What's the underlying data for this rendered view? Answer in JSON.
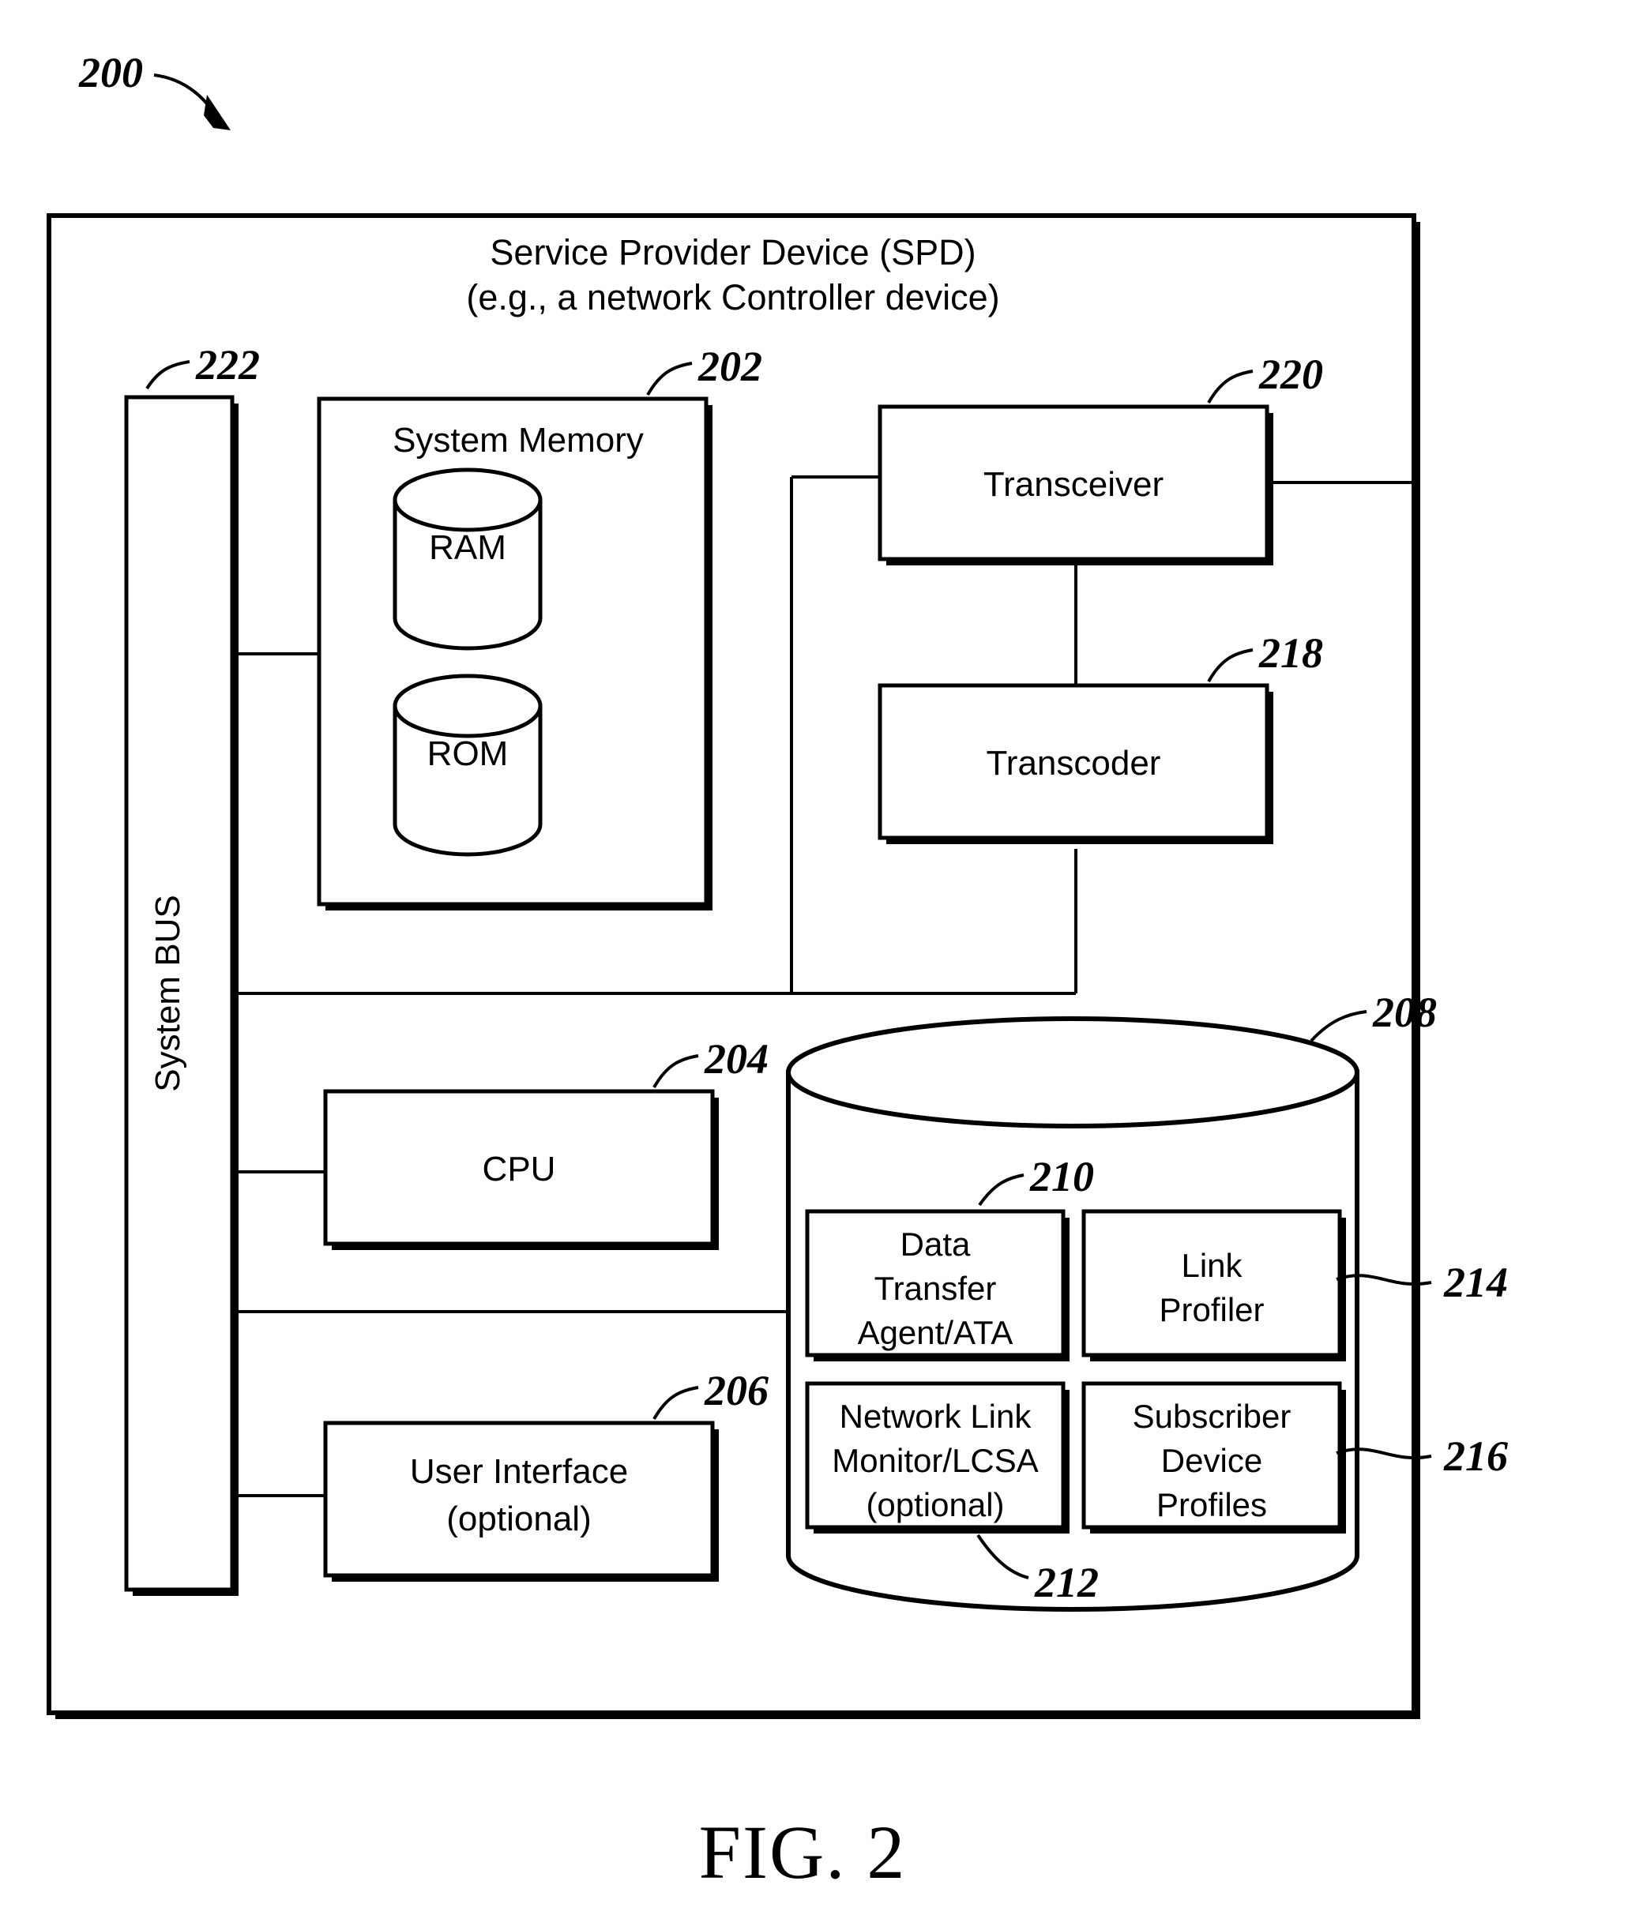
{
  "figure": {
    "caption": "FIG. 2",
    "root_ref": "200"
  },
  "spd": {
    "ref": "",
    "title_line1": "Service Provider Device (SPD)",
    "title_line2": "(e.g., a network Controller device)"
  },
  "bus": {
    "label": "System BUS",
    "ref": "222"
  },
  "system_memory": {
    "label": "System Memory",
    "ref": "202",
    "ram": "RAM",
    "rom": "ROM"
  },
  "transceiver": {
    "label": "Transceiver",
    "ref": "220"
  },
  "transcoder": {
    "label": "Transcoder",
    "ref": "218"
  },
  "cpu": {
    "label": "CPU",
    "ref": "204"
  },
  "user_interface": {
    "label_line1": "User Interface",
    "label_line2": "(optional)",
    "ref": "206"
  },
  "datastore": {
    "ref": "208",
    "items": [
      {
        "ref": "210",
        "lines": [
          "Data",
          "Transfer",
          "Agent/ATA"
        ]
      },
      {
        "ref": "214",
        "lines": [
          "Link",
          "Profiler"
        ]
      },
      {
        "ref": "212",
        "lines": [
          "Network Link",
          "Monitor/LCSA",
          "(optional)"
        ]
      },
      {
        "ref": "216",
        "lines": [
          "Subscriber",
          "Device",
          "Profiles"
        ]
      }
    ]
  },
  "colors": {
    "ink": "#000000",
    "paper": "#ffffff"
  }
}
